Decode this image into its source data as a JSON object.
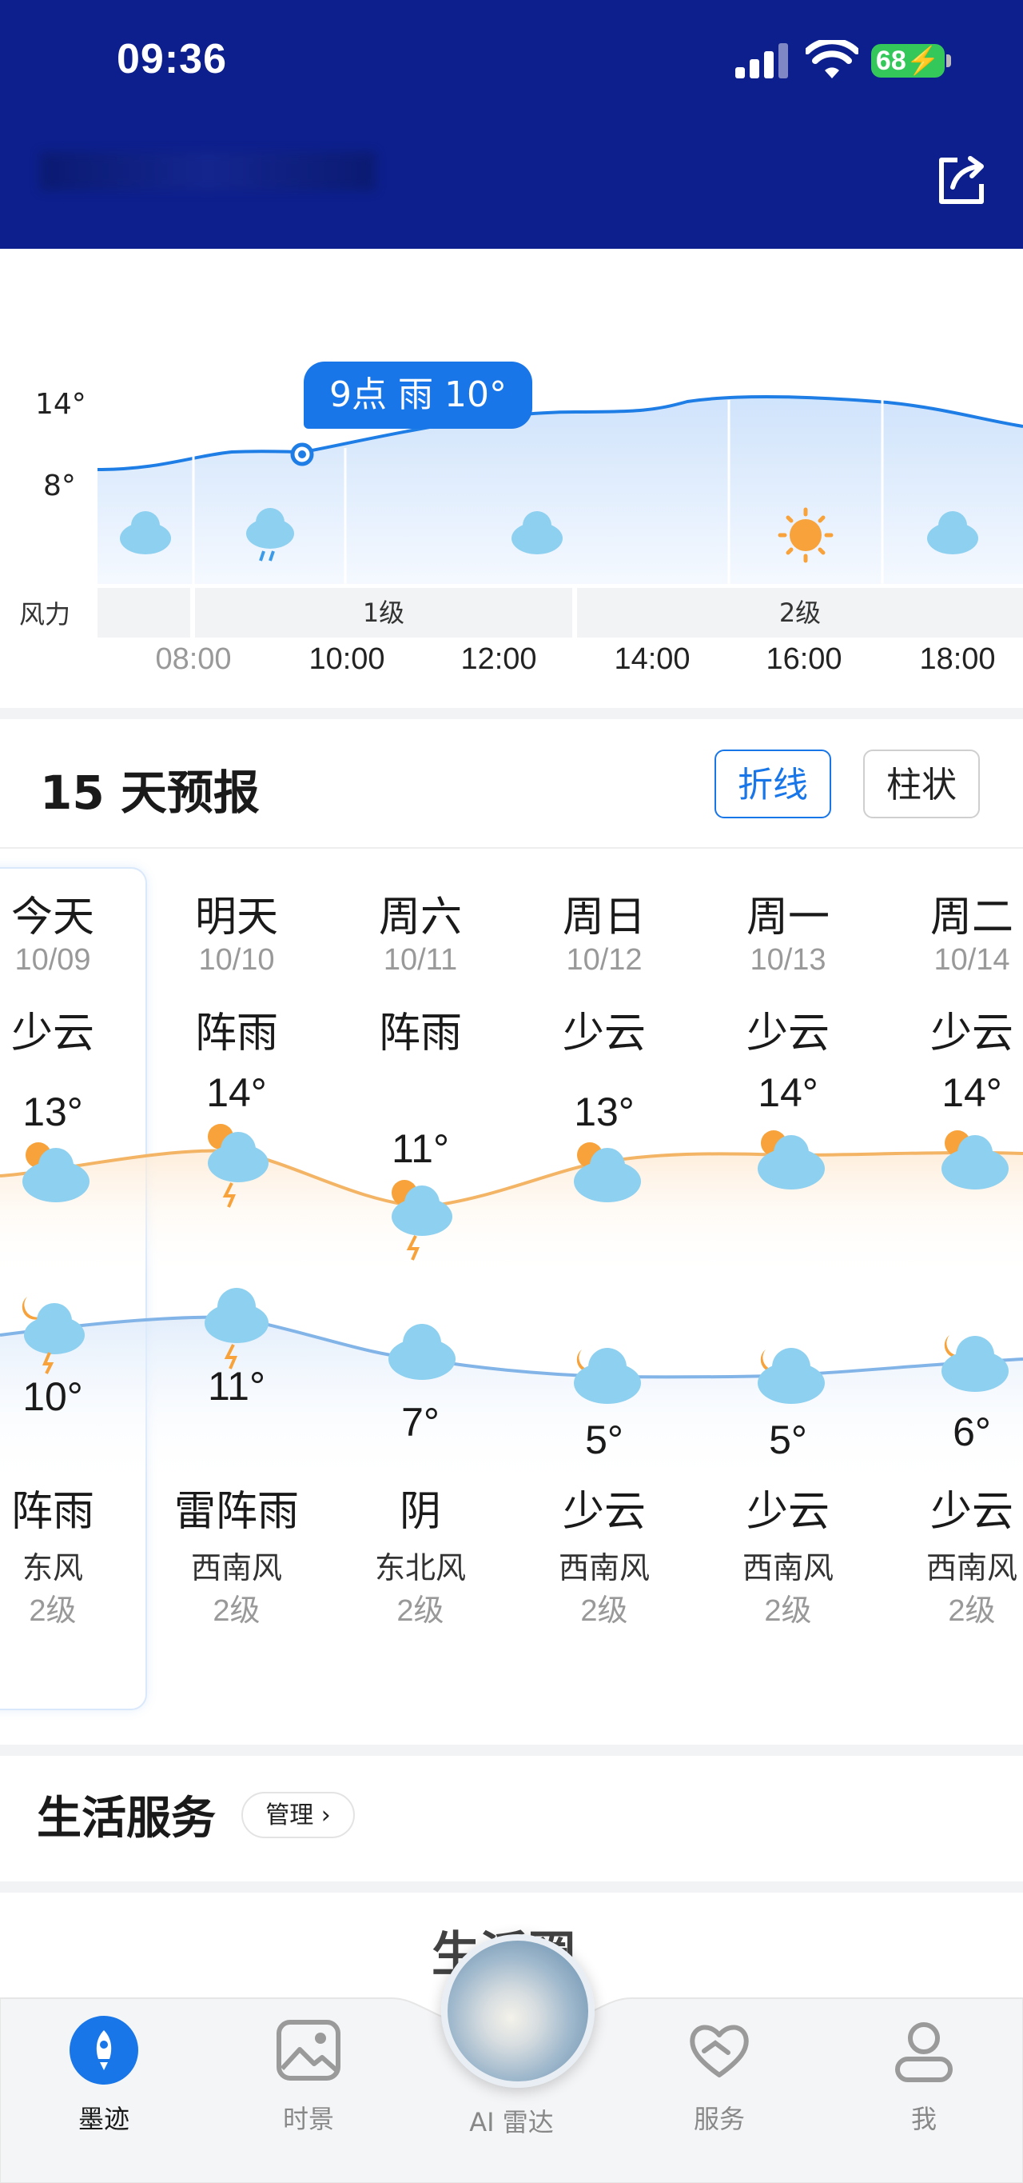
{
  "status_bar": {
    "time": "09:36",
    "battery": "68"
  },
  "hourly": {
    "tooltip": "9点 雨 10°",
    "y_labels": [
      "14°",
      "8°"
    ],
    "wind_label": "风力",
    "wind_levels": [
      "1级",
      "2级"
    ],
    "times": [
      "08:00",
      "10:00",
      "12:00",
      "14:00",
      "16:00",
      "18:00"
    ],
    "icons": [
      "cloud-icon",
      "rain-cloud-icon",
      "cloud-icon",
      "sun-icon",
      "cloud-icon"
    ]
  },
  "forecast": {
    "title": "15 天预报",
    "toggle_line": "折线",
    "toggle_bar": "柱状",
    "days": [
      {
        "day": "今天",
        "date": "10/09",
        "wx": "少云",
        "hi": "13°",
        "lo": "10°",
        "nwx": "阵雨",
        "wind": "东风",
        "level": "2级"
      },
      {
        "day": "明天",
        "date": "10/10",
        "wx": "阵雨",
        "hi": "14°",
        "lo": "11°",
        "nwx": "雷阵雨",
        "wind": "西南风",
        "level": "2级"
      },
      {
        "day": "周六",
        "date": "10/11",
        "wx": "阵雨",
        "hi": "11°",
        "lo": "7°",
        "nwx": "阴",
        "wind": "东北风",
        "level": "2级"
      },
      {
        "day": "周日",
        "date": "10/12",
        "wx": "少云",
        "hi": "13°",
        "lo": "5°",
        "nwx": "少云",
        "wind": "西南风",
        "level": "2级"
      },
      {
        "day": "周一",
        "date": "10/13",
        "wx": "少云",
        "hi": "14°",
        "lo": "5°",
        "nwx": "少云",
        "wind": "西南风",
        "level": "2级"
      },
      {
        "day": "周二",
        "date": "10/14",
        "wx": "少云",
        "hi": "14°",
        "lo": "6°",
        "nwx": "少云",
        "wind": "西南风",
        "level": "2级"
      }
    ]
  },
  "life_service": {
    "title": "生活服务",
    "manage": "管理 ›",
    "sub": "生活圈"
  },
  "nav": {
    "items": [
      {
        "label": "墨迹",
        "icon": "rocket-icon"
      },
      {
        "label": "时景",
        "icon": "picture-icon"
      },
      {
        "label": "AI 雷达",
        "icon": "radar-orb-icon"
      },
      {
        "label": "服务",
        "icon": "heart-hand-icon"
      },
      {
        "label": "我",
        "icon": "person-icon"
      }
    ]
  },
  "colors": {
    "header": "#0d1f8c",
    "accent": "#1876e8",
    "high_line": "#f2b35e",
    "low_line": "#7fb0e6"
  }
}
